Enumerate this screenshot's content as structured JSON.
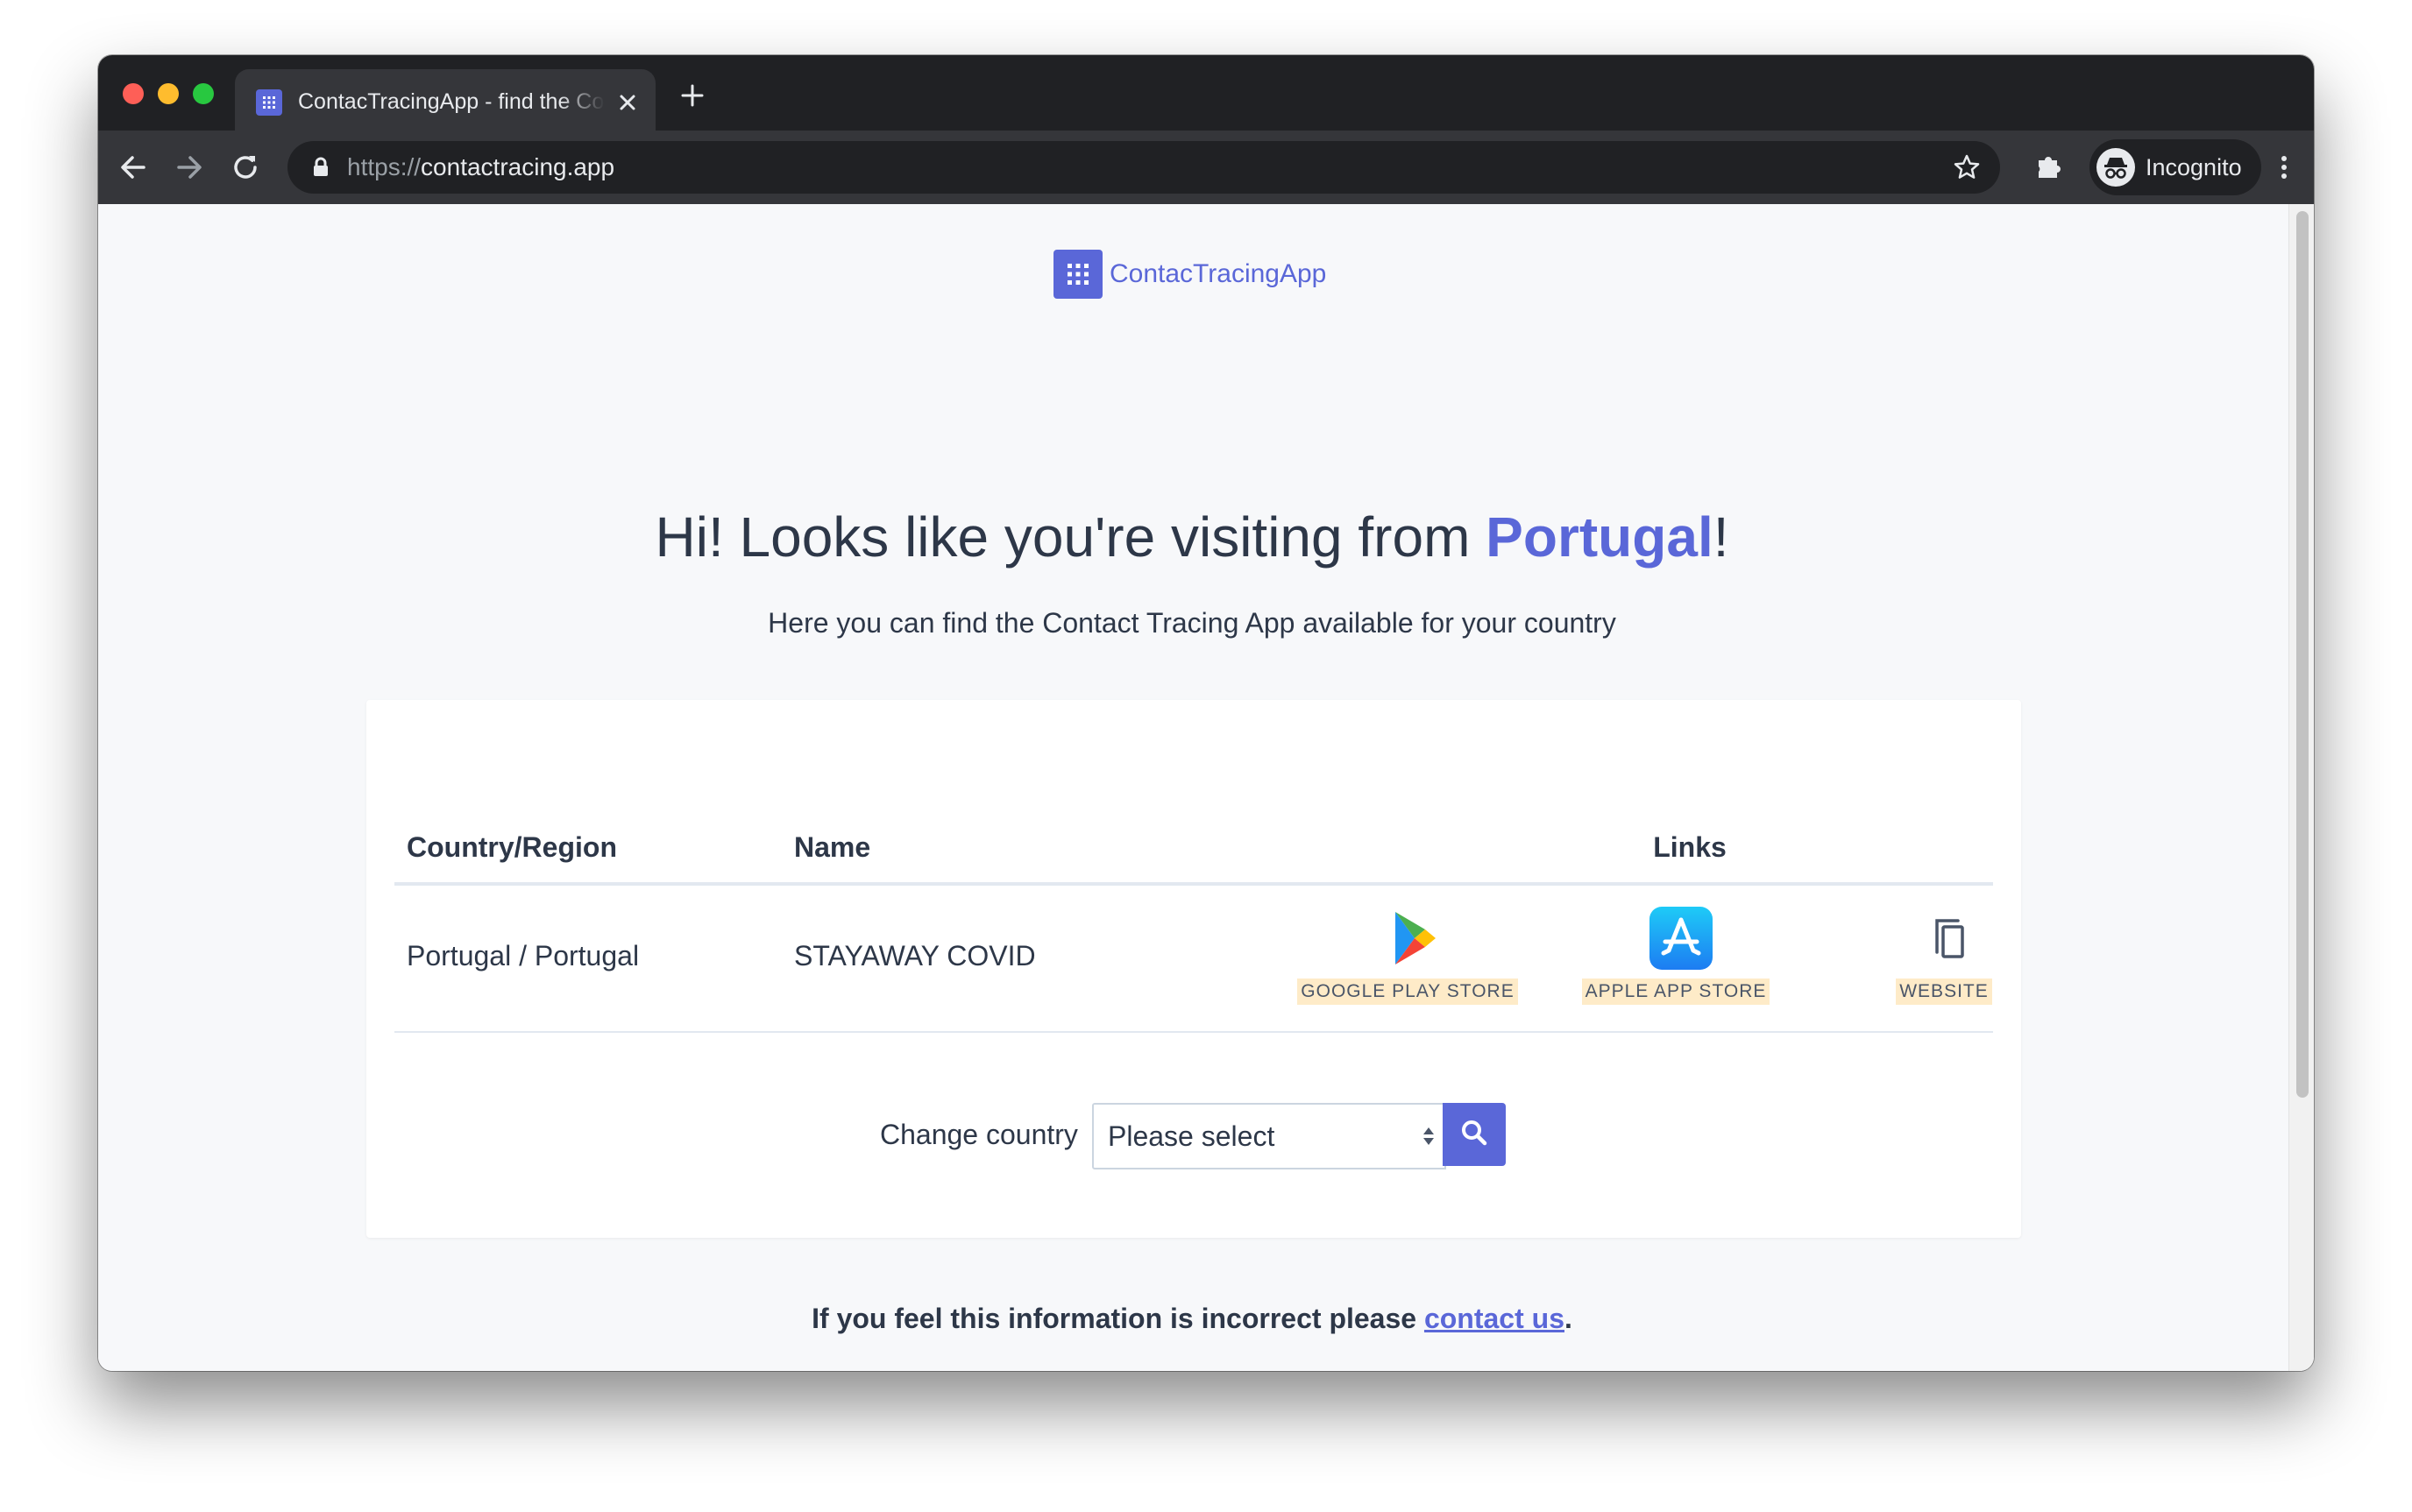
{
  "browser": {
    "tab_title": "ContacTracingApp - find the Contact Tracing App for your country",
    "url_scheme": "https://",
    "url_host": "contactracing.app",
    "profile_label": "Incognito"
  },
  "brand": {
    "name": "ContacTracingApp",
    "color": "#5a67d8"
  },
  "hero": {
    "prefix": "Hi! Looks like you're visiting from ",
    "country": "Portugal",
    "suffix": "!",
    "subtitle": "Here you can find the Contact Tracing App available for your country"
  },
  "table": {
    "headers": {
      "country": "Country/Region",
      "name": "Name",
      "links": "Links"
    },
    "rows": [
      {
        "country": "Portugal / Portugal",
        "name": "STAYAWAY COVID",
        "links": {
          "google_play": "GOOGLE PLAY STORE",
          "app_store": "APPLE APP STORE",
          "website": "WEBSITE"
        }
      }
    ]
  },
  "change_country": {
    "label": "Change country",
    "selected": "Please select"
  },
  "footer": {
    "prefix": "If you feel this information is incorrect please ",
    "link": "contact us",
    "suffix": "."
  },
  "icons": [
    "grid-icon",
    "close-icon",
    "plus-icon",
    "back-arrow-icon",
    "forward-arrow-icon",
    "reload-icon",
    "lock-icon",
    "star-icon",
    "puzzle-icon",
    "incognito-icon",
    "more-vert-icon",
    "google-play-icon",
    "app-store-icon",
    "copy-icon",
    "search-icon"
  ]
}
